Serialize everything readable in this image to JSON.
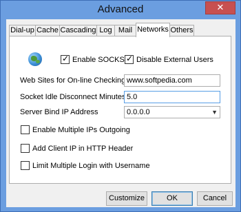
{
  "window": {
    "title": "Advanced",
    "close_label": "✕"
  },
  "tabs": [
    "Dial-up",
    "Cache",
    "Cascading",
    "Log",
    "Mail",
    "Networks",
    "Others"
  ],
  "active_tab": "Networks",
  "networks": {
    "enable_socks4": {
      "label": "Enable SOCKS4",
      "checked": true
    },
    "disable_external_users": {
      "label": "Disable External Users",
      "checked": true
    },
    "web_sites_label": "Web Sites for On-line Checking",
    "web_sites_value": "www.softpedia.com",
    "idle_disconnect_label": "Socket Idle Disconnect Minutes",
    "idle_disconnect_value": "5.0",
    "bind_ip_label": "Server Bind IP Address",
    "bind_ip_value": "0.0.0.0",
    "enable_multiple_ips": {
      "label": "Enable Multiple IPs Outgoing",
      "checked": false
    },
    "add_client_ip": {
      "label": "Add Client IP in HTTP Header",
      "checked": false
    },
    "limit_multiple_login": {
      "label": "Limit Multiple Login with Username",
      "checked": false
    }
  },
  "buttons": {
    "customize": "Customize",
    "ok": "OK",
    "cancel": "Cancel"
  },
  "icons": {
    "globe": "globe-icon",
    "dropdown": "chevron-down-icon",
    "close": "close-icon"
  },
  "colors": {
    "titlebar": "#6b9ee0",
    "close": "#c75050",
    "focus_border": "#569de5"
  }
}
